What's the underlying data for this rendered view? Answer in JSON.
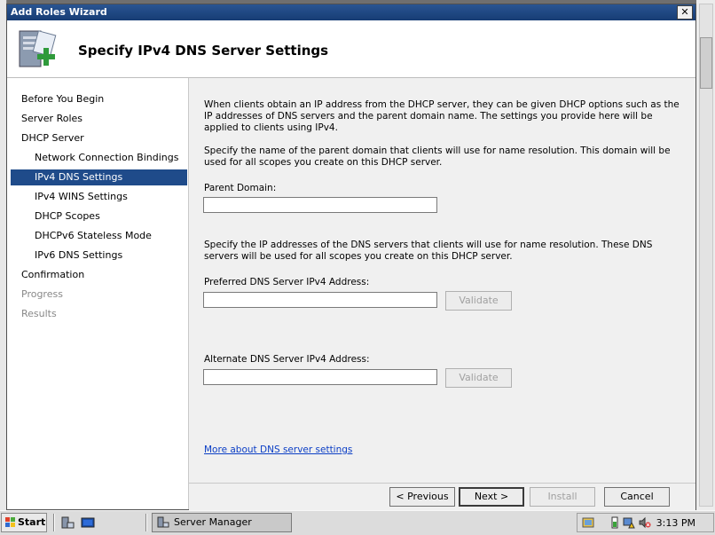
{
  "window": {
    "title": "Add Roles Wizard",
    "close_glyph": "✕"
  },
  "header": {
    "title": "Specify IPv4 DNS Server Settings",
    "icon": "server-roles-add-icon"
  },
  "nav": {
    "items": [
      {
        "label": "Before You Begin",
        "state": "normal"
      },
      {
        "label": "Server Roles",
        "state": "normal"
      },
      {
        "label": "DHCP Server",
        "state": "normal"
      },
      {
        "label": "Network Connection Bindings",
        "state": "sub"
      },
      {
        "label": "IPv4 DNS Settings",
        "state": "selected"
      },
      {
        "label": "IPv4 WINS Settings",
        "state": "sub"
      },
      {
        "label": "DHCP Scopes",
        "state": "sub"
      },
      {
        "label": "DHCPv6 Stateless Mode",
        "state": "sub"
      },
      {
        "label": "IPv6 DNS Settings",
        "state": "sub"
      },
      {
        "label": "Confirmation",
        "state": "normal"
      },
      {
        "label": "Progress",
        "state": "disabled"
      },
      {
        "label": "Results",
        "state": "disabled"
      }
    ]
  },
  "content": {
    "intro": "When clients obtain an IP address from the DHCP server, they can be given DHCP options such as the IP addresses of DNS servers and the parent domain name. The settings you provide here will be applied to clients using IPv4.",
    "domain_help": "Specify the name of the parent domain that clients will use for name resolution. This domain will be used for all scopes you create on this DHCP server.",
    "parent_domain_label": "Parent Domain:",
    "parent_domain_value": "",
    "dns_help": "Specify the IP addresses of the DNS servers that clients will use for name resolution. These DNS servers will be used for all scopes you create on this DHCP server.",
    "preferred_label": "Preferred DNS Server IPv4 Address:",
    "preferred_value": "",
    "alternate_label": "Alternate DNS Server IPv4 Address:",
    "alternate_value": "",
    "validate_label": "Validate",
    "more_link": "More about DNS server settings"
  },
  "footer": {
    "previous": "< Previous",
    "next": "Next >",
    "install": "Install",
    "cancel": "Cancel"
  },
  "taskbar": {
    "start": "Start",
    "task": "Server Manager",
    "clock": "3:13 PM"
  },
  "colors": {
    "selection": "#1f4b8a",
    "titlebar": "#2a5592",
    "link": "#0b3ec5"
  }
}
